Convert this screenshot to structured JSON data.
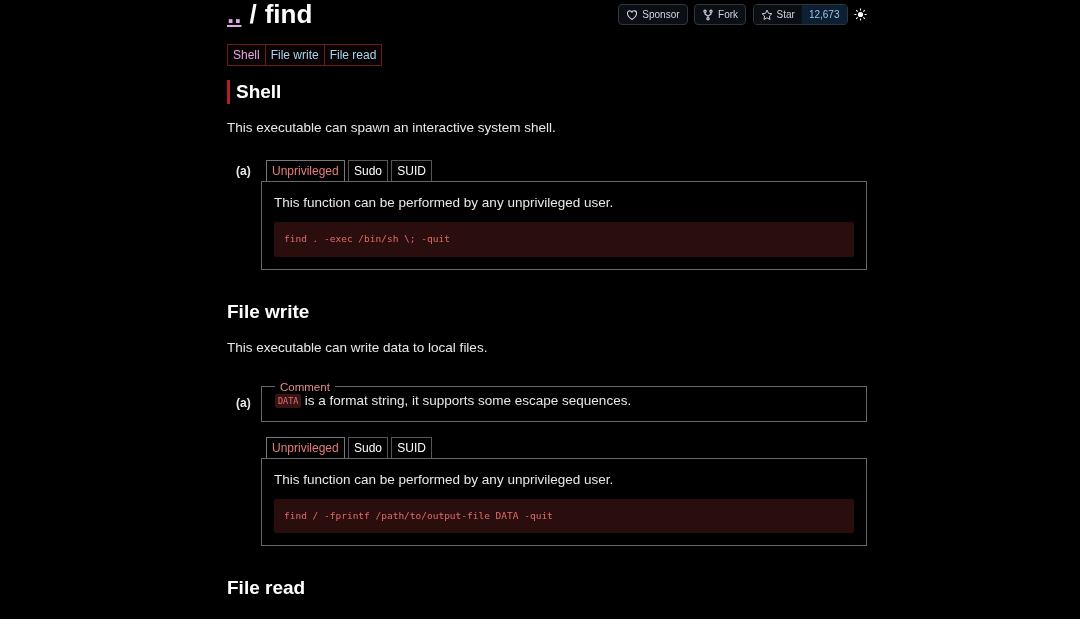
{
  "header": {
    "parent_link": "..",
    "separator": "/",
    "title": "find"
  },
  "repo_buttons": [
    {
      "kind": "sponsor",
      "label": "Sponsor"
    },
    {
      "kind": "fork",
      "label": "Fork"
    },
    {
      "kind": "star",
      "label": "Star",
      "count": "12,673"
    }
  ],
  "tags": [
    {
      "label": "Shell",
      "color": "#e3a6e6"
    },
    {
      "label": "File write",
      "color": "#a9d6f2"
    },
    {
      "label": "File read",
      "color": "#a9d6f2"
    }
  ],
  "sections": [
    {
      "title": "Shell",
      "highlighted": true,
      "description": "This executable can spawn an interactive system shell.",
      "examples": [
        {
          "label": "(a)",
          "tabs": [
            {
              "label": "Unprivileged",
              "selected": true
            },
            {
              "label": "Sudo",
              "selected": false
            },
            {
              "label": "SUID",
              "selected": false
            }
          ],
          "note": "This function can be performed by any unprivileged user.",
          "code": "find . -exec /bin/sh \\; -quit"
        }
      ]
    },
    {
      "title": "File write",
      "highlighted": false,
      "description": "This executable can write data to local files.",
      "examples": [
        {
          "label": "(a)",
          "comment": {
            "legend": "Comment",
            "code": "DATA",
            "text": "is a format string, it supports some escape sequences."
          },
          "tabs": [
            {
              "label": "Unprivileged",
              "selected": true
            },
            {
              "label": "Sudo",
              "selected": false
            },
            {
              "label": "SUID",
              "selected": false
            }
          ],
          "note": "This function can be performed by any unprivileged user.",
          "code": "find / -fprintf /path/to/output-file DATA -quit"
        }
      ]
    },
    {
      "title": "File read",
      "highlighted": false
    }
  ]
}
